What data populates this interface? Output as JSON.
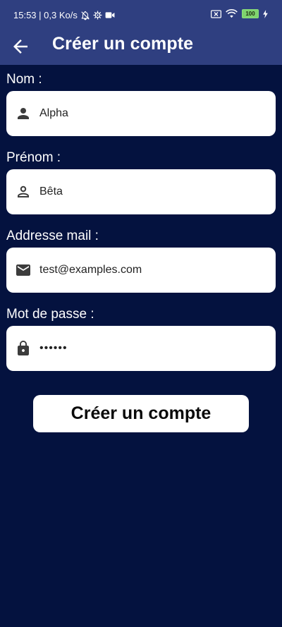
{
  "status_bar": {
    "time_info": "15:53 | 0,3 Ko/s",
    "battery_level": "100"
  },
  "app_bar": {
    "title": "Créer un compte"
  },
  "form": {
    "fields": [
      {
        "label": "Nom :",
        "value": "Alpha",
        "icon": "person-filled-icon"
      },
      {
        "label": "Prénom :",
        "value": "Bêta",
        "icon": "person-outline-icon"
      },
      {
        "label": "Addresse mail :",
        "value": "test@examples.com",
        "icon": "email-icon"
      },
      {
        "label": "Mot de passe :",
        "value": "••••••",
        "icon": "lock-icon"
      }
    ],
    "submit_label": "Créer un compte"
  },
  "colors": {
    "background": "#04123f",
    "app_bar": "#2f3f80",
    "field_background": "#ffffff",
    "icon": "#3c3c3c",
    "battery": "#7fd36e"
  }
}
